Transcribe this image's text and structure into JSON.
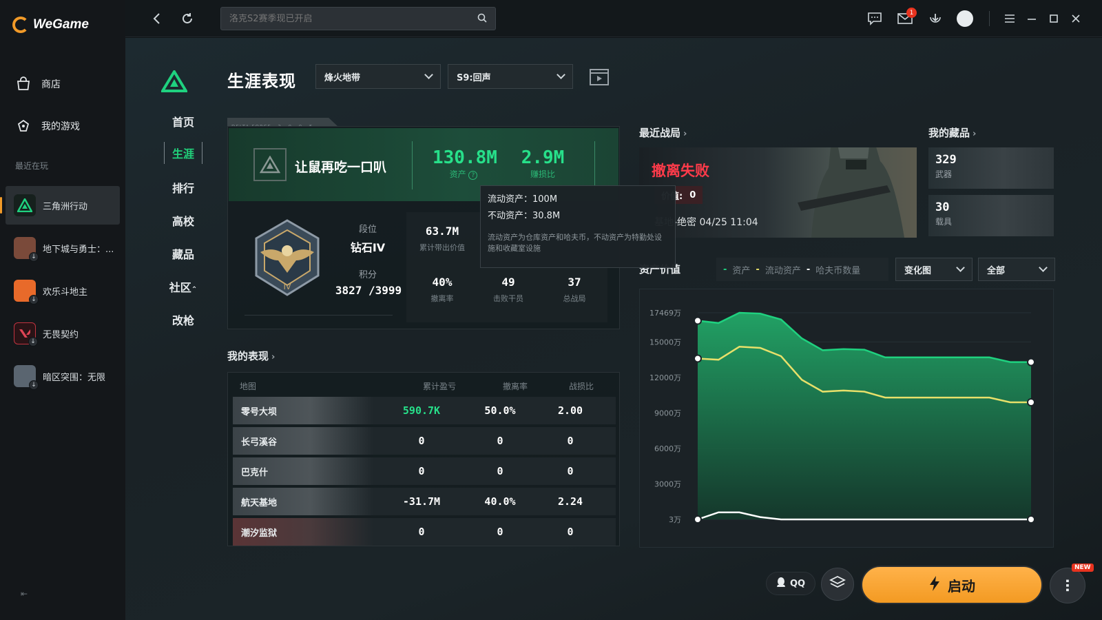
{
  "app": {
    "name": "WeGame"
  },
  "sidebar": {
    "nav": [
      {
        "label": "商店",
        "icon": "store-icon"
      },
      {
        "label": "我的游戏",
        "icon": "gamepad-icon"
      }
    ],
    "recent_label": "最近在玩",
    "games": [
      {
        "label": "三角洲行动",
        "active": true,
        "color": "#16201d"
      },
      {
        "label": "地下城与勇士：...",
        "color": "#7a4a3a"
      },
      {
        "label": "欢乐斗地主",
        "color": "#e86a2a"
      },
      {
        "label": "无畏契约",
        "color": "#c23340"
      },
      {
        "label": "暗区突围：无限",
        "color": "#5a6570"
      }
    ]
  },
  "topbar": {
    "search_placeholder": "洛克S2赛季现已开启",
    "mail_badge": "1"
  },
  "game_nav": {
    "items": [
      "首页",
      "生涯",
      "排行",
      "高校",
      "藏品",
      "社区",
      "改枪"
    ],
    "active": "生涯"
  },
  "page": {
    "title": "生涯表现",
    "mode_dropdown": "烽火地带",
    "season_dropdown": "S9:回声"
  },
  "profile": {
    "banner_text": "DELTA FORCE · 2 · 0 · 0 · 5",
    "name": "让鼠再吃一口叭",
    "assets_value": "130.8M",
    "assets_label": "资产",
    "ratio_value": "2.9M",
    "ratio_label": "赚损比",
    "rank_label": "段位",
    "rank_value": "钻石IV",
    "score_label": "积分",
    "score_value": "3827 /3999",
    "stats": [
      {
        "value": "63.7M",
        "label": "累计带出价值"
      },
      {
        "value": "40%",
        "label": "撤离率"
      },
      {
        "value": "49",
        "label": "击败干员"
      },
      {
        "value": "37",
        "label": "总战局"
      }
    ]
  },
  "tooltip": {
    "line1": "流动资产：100M",
    "line2": "不动资产：30.8M",
    "note": "流动资产为仓库资产和哈夫币，不动资产为特勤处设施和收藏室设施"
  },
  "performance": {
    "title": "我的表现",
    "headers": [
      "地图",
      "累计盈亏",
      "撤离率",
      "战损比"
    ],
    "rows": [
      {
        "map": "零号大坝",
        "profit": "590.7K",
        "rate": "50.0%",
        "kd": "2.00",
        "highlight": true
      },
      {
        "map": "长弓溪谷",
        "profit": "0",
        "rate": "0",
        "kd": "0"
      },
      {
        "map": "巴克什",
        "profit": "0",
        "rate": "0",
        "kd": "0"
      },
      {
        "map": "航天基地",
        "profit": "-31.7M",
        "rate": "40.0%",
        "kd": "2.24"
      },
      {
        "map": "潮汐监狱",
        "profit": "0",
        "rate": "0",
        "kd": "0"
      }
    ]
  },
  "recent_battle": {
    "title": "最近战局",
    "result": "撤离失败",
    "value_label": "价值:",
    "value": "0",
    "map_time": "基地-绝密  04/25 11:04"
  },
  "collection": {
    "title": "我的藏品",
    "items": [
      {
        "value": "329",
        "label": "武器"
      },
      {
        "value": "30",
        "label": "载具"
      }
    ]
  },
  "asset_chart": {
    "title": "资产价值",
    "legend": [
      {
        "label": "资产",
        "color": "#1fd17f"
      },
      {
        "label": "流动资产",
        "color": "#e8e06a"
      },
      {
        "label": "哈夫币数量",
        "color": "#ffffff"
      }
    ],
    "view_dropdown": "变化图",
    "filter_dropdown": "全部",
    "y_ticks": [
      "17469万",
      "15000万",
      "12000万",
      "9000万",
      "6000万",
      "3000万",
      "3万"
    ]
  },
  "chart_data": {
    "type": "area",
    "ylim": [
      3,
      17469
    ],
    "series": [
      {
        "name": "资产",
        "values": [
          16800,
          16600,
          17469,
          17400,
          16900,
          15300,
          14300,
          14400,
          14350,
          13700,
          13700,
          13700,
          13700,
          13700,
          13700,
          13300,
          13300
        ]
      },
      {
        "name": "流动资产",
        "values": [
          13600,
          13500,
          14600,
          14500,
          13800,
          11800,
          10800,
          10900,
          10800,
          10300,
          10300,
          10300,
          10300,
          10300,
          10300,
          9900,
          9900
        ]
      },
      {
        "name": "哈夫币数量",
        "values": [
          3,
          600,
          600,
          200,
          3,
          3,
          3,
          3,
          3,
          3,
          3,
          3,
          3,
          3,
          3,
          3,
          3
        ]
      }
    ]
  },
  "actions": {
    "qq_label": "QQ",
    "start_label": "启动",
    "new_badge": "NEW"
  }
}
